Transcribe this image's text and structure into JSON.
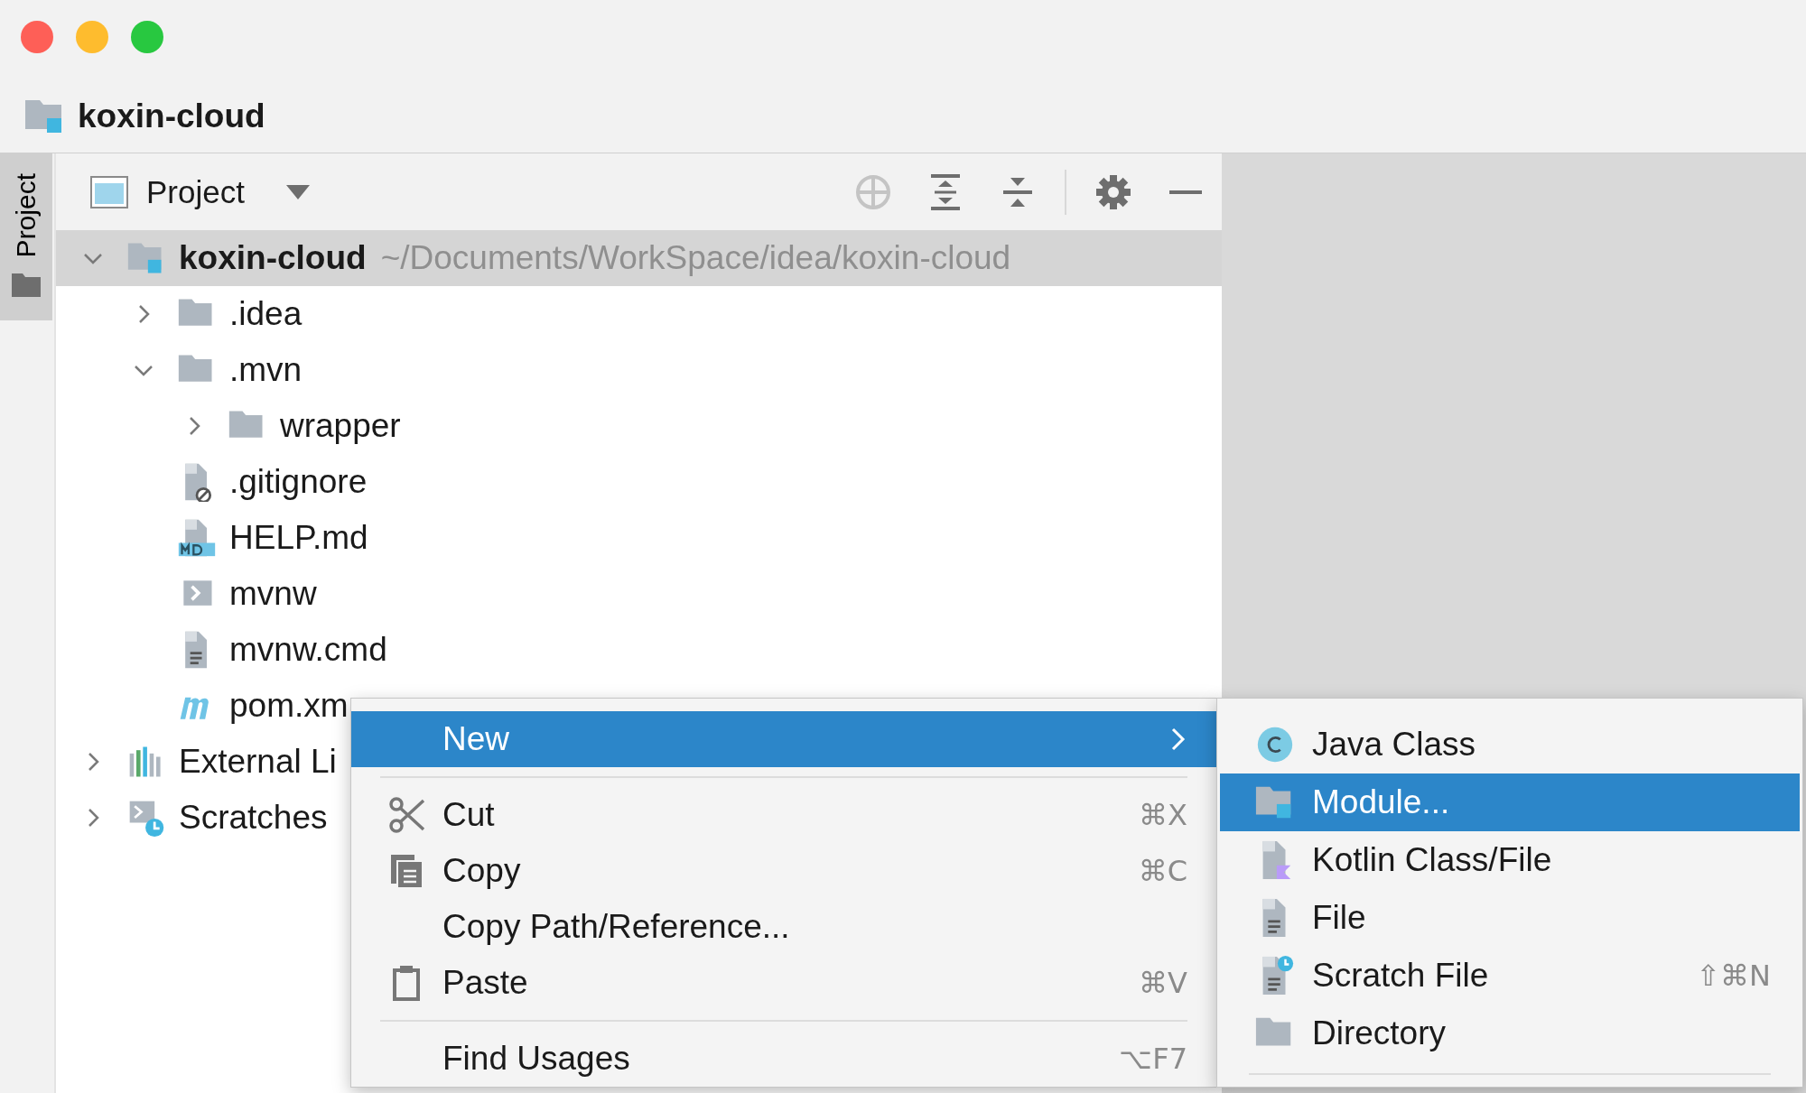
{
  "window": {
    "traffic_lights": [
      {
        "color": "#fe5f57"
      },
      {
        "color": "#febc2e"
      },
      {
        "color": "#28c840"
      }
    ]
  },
  "breadcrumb": {
    "label": "koxin-cloud"
  },
  "side_tab": {
    "label": "Project",
    "selected": true
  },
  "toolbar": {
    "view": "Project"
  },
  "tree": [
    {
      "label": "koxin-cloud",
      "path": "~/Documents/WorkSpace/idea/koxin-cloud",
      "kind": "module",
      "expanded": true,
      "selected": true,
      "children": [
        {
          "label": ".idea",
          "kind": "folder",
          "expanded": false,
          "selected": false
        },
        {
          "label": ".mvn",
          "kind": "folder",
          "expanded": true,
          "selected": false,
          "children": [
            {
              "label": "wrapper",
              "kind": "folder",
              "expanded": false,
              "selected": false
            }
          ]
        },
        {
          "label": ".gitignore",
          "kind": "ignore",
          "selected": false
        },
        {
          "label": "HELP.md",
          "kind": "markdown",
          "selected": false
        },
        {
          "label": "mvnw",
          "kind": "script",
          "selected": false
        },
        {
          "label": "mvnw.cmd",
          "kind": "text",
          "selected": false
        },
        {
          "label": "pom.xm",
          "kind": "maven",
          "selected": false
        }
      ]
    },
    {
      "label": "External Li",
      "kind": "libraries",
      "expanded": false,
      "selected": false
    },
    {
      "label": "Scratches",
      "kind": "scratches",
      "expanded": false,
      "selected": false
    }
  ],
  "context_menu": {
    "groups": [
      [
        {
          "label": "New",
          "submenu": true,
          "selected": true
        }
      ],
      [
        {
          "label": "Cut",
          "kind": "scissors",
          "shortcut": "⌘X",
          "selected": false
        },
        {
          "label": "Copy",
          "kind": "copy",
          "shortcut": "⌘C",
          "selected": false
        },
        {
          "label": "Copy Path/Reference...",
          "selected": false
        },
        {
          "label": "Paste",
          "kind": "clipboard",
          "shortcut": "⌘V",
          "selected": false
        }
      ],
      [
        {
          "label": "Find Usages",
          "shortcut": "⌥F7",
          "selected": false
        }
      ]
    ]
  },
  "submenu": {
    "groups": [
      [
        {
          "label": "Java Class",
          "kind": "class",
          "selected": false
        },
        {
          "label": "Module...",
          "kind": "module",
          "selected": true
        },
        {
          "label": "Kotlin Class/File",
          "kind": "kotlin",
          "selected": false
        },
        {
          "label": "File",
          "kind": "text",
          "selected": false
        },
        {
          "label": "Scratch File",
          "kind": "scratch",
          "shortcut": "⇧⌘N",
          "selected": false
        },
        {
          "label": "Directory",
          "kind": "folder",
          "selected": false
        }
      ]
    ]
  }
}
